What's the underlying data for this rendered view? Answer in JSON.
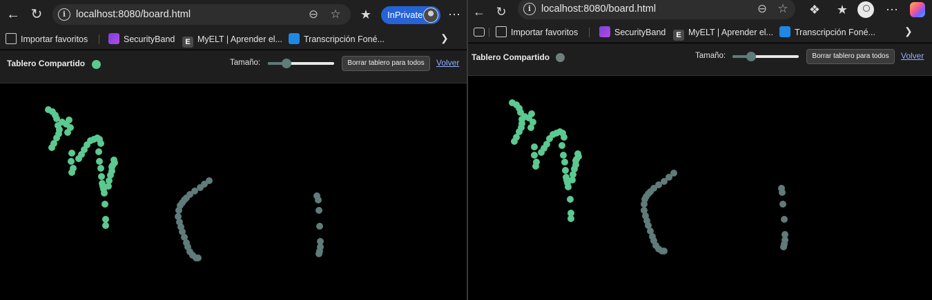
{
  "browser": {
    "url": "localhost:8080/board.html",
    "inprivate_label": "InPrivate",
    "favorites": [
      {
        "label": "Importar favoritos",
        "icon": "folder-import-icon"
      },
      {
        "label": "SecurityBand",
        "icon": "securityband-icon"
      },
      {
        "label": "MyELT | Aprender el...",
        "icon": "myelt-icon"
      },
      {
        "label": "Transcripción Foné...",
        "icon": "transcription-icon"
      }
    ]
  },
  "app": {
    "title": "Tablero Compartido",
    "size_label": "Tamaño:",
    "clear_button": "Borrar tablero para todos",
    "back_link": "Volver",
    "brush_size_fraction": 0.28
  },
  "colors": {
    "green": "#5bc990",
    "gray": "#5f7b7a",
    "status_connected": "#5bc990",
    "status_disconnected": "#6f7f7e",
    "accent_inprivate": "#2563d6",
    "link": "#8fb0ff"
  },
  "windows": [
    {
      "status": "connected"
    },
    {
      "status": "disconnected"
    }
  ]
}
